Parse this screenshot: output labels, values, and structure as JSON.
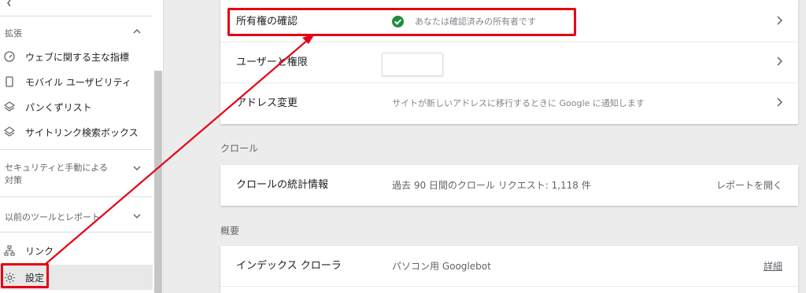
{
  "sidebar": {
    "sections": {
      "enhancements": "拡張",
      "security": "セキュリティと手動による\n対策",
      "legacy": "以前のツールとレポート"
    },
    "items": [
      {
        "label": "ウェブに関する主な指標",
        "icon": "gauge-icon"
      },
      {
        "label": "モバイル ユーザビリティ",
        "icon": "phone-icon"
      },
      {
        "label": "パンくずリスト",
        "icon": "layers-icon"
      },
      {
        "label": "サイトリンク検索ボックス",
        "icon": "layers-icon"
      },
      {
        "label": "リンク",
        "icon": "sitemap-icon"
      },
      {
        "label": "設定",
        "icon": "gear-icon"
      }
    ]
  },
  "ownership_card": {
    "rows": [
      {
        "name": "所有権の確認",
        "value": "あなたは確認済みの所有者です"
      },
      {
        "name": "ユーザーと権限",
        "value": ""
      },
      {
        "name": "アドレス変更",
        "value": "サイトが新しいアドレスに移行するときに Google に通知します"
      }
    ]
  },
  "crawl": {
    "section_title": "クロール",
    "row": {
      "name": "クロールの統計情報",
      "value": "過去 90 日間のクロール リクエスト: 1,118 件",
      "link": "レポートを開く"
    }
  },
  "overview": {
    "section_title": "概要",
    "row": {
      "name": "インデックス クローラ",
      "value": "パソコン用 Googlebot",
      "link": "詳細"
    }
  },
  "colors": {
    "annotation": "#e60012",
    "verified_green": "#1e8e3e"
  }
}
